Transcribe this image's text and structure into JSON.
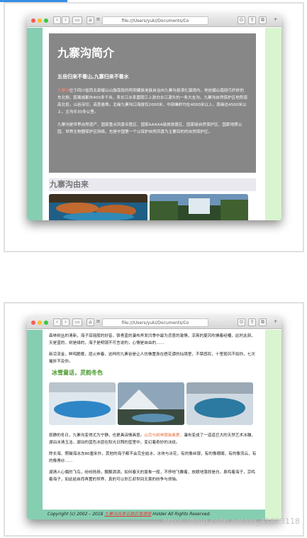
{
  "browser": {
    "url": "file:///Users/yuki/Documents/Co",
    "nav_back": "‹",
    "nav_forward": "›"
  },
  "page1": {
    "title": "九寨沟简介",
    "tagline": "五岳归来不看山,九寨归来不看水",
    "para1_highlight": "九寨沟",
    "para1": "位于四川省西北部岷山山脉南段的阿坝藏族羌族自治州九寨沟县漳扎镇境内，地处岷山南段弓杆岭的东北侧，距离成都市400多千米，系长江水系嘉陵江上游白水江源头的一条大支沟。九寨沟自然保护区地势南高北低，山谷深切，高差悬殊。北缘九寨沟口海拔仅2000米，中部峰岭均在4000米以上，南缘达4500米以上，主沟长30多公里。",
    "para2": "九寨沟是世界自然遗产、国家重点风景名胜区、国家AAAAA级旅游景区、国家级自然保护区、国家地质公园、世界生物圈保护区网络，也是中国第一个以保护自然风景为主要目的的自然保护区。",
    "section_title": "九寨沟由来"
  },
  "page2": {
    "para1": "森林树丛的清新，海子琼瑶般的妙音，铁青蓝的瀑布斧发凹季中最为恣意的激情，凉爽的夏风吹拂着经幡，此时此刻，天是蓝的，树是绿的，海子是明镜不可言说的，心情是自由的……",
    "para2": "新凉流金，鲜鸣脆歌，层火奔春，这样的九寨谷是让人仿佛置身在梧花谭的仙境里，不禁感叹，十里斑风不如你，七次摧折不及你。",
    "section": "冰雪童话，灵韵冬色",
    "para3_before": "寂静的冬日，九寨沟变得尤为宁静，也更具诗情画意。",
    "para3_highlight": "山峦与树林银装素裹，",
    "para3_after": "瀑布变成了一道道巨大的天然艺术冰雕，湖泊冰清玉洁，湖泊的蓝色冰层在阳光日照的蓝里中，变幻着奇妙的冰纹。",
    "para4": "除长海、照猫海冰冻80厘米外，其他的海子都不会完全结冰，冰块与冰花，有的像丝银，有的像珊瑚，有的像流云，有的像青纱……",
    "para5": "湖清人心偶的飞鸟，纷纷扬扬，飘飘洒洒，如何春天的景象一般，不停地飞舞着，放眼地落即是白，泉鸣着海子，京鸣着海子，如此给自而再置的世界，真的可以你忘却世间无畏的纷争与烦恼。",
    "footer_prefix": "Copyright (c) 2002 – 2018 ",
    "footer_link": "九寨沟风景名胜区管理局",
    "footer_suffix": " Holder All Rights Reserved."
  },
  "watermark": "https://blog.csdn.net/qq_45823118",
  "colors": {
    "sidebar_left": "#86ceb2",
    "sidebar_right": "#d9f5cf",
    "hero_bg": "#878787",
    "accent_green": "#4a9a2c",
    "link_red": "#e23b3b"
  }
}
